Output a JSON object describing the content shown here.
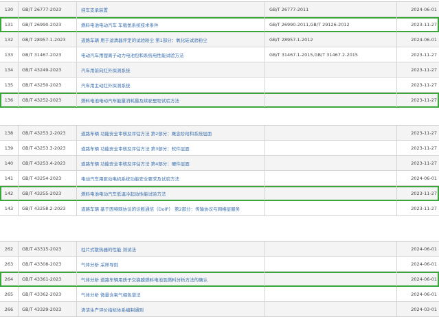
{
  "sections": [
    {
      "rows": [
        {
          "num": "130",
          "code": "GB/T 26777-2023",
          "title": "挂车支承装置",
          "replaces": "GB/T 26777-2011",
          "date": "2024-06-01",
          "highlight": false
        },
        {
          "num": "131",
          "code": "GB/T 26990-2023",
          "title": "燃料电池电动汽车 车载氢系统技术条件",
          "replaces": "GB/T 26990-2011,GB/T 29126-2012",
          "date": "2023-11-27",
          "highlight": true
        },
        {
          "num": "132",
          "code": "GB/T 28957.1-2023",
          "title": "道路车辆 用于滤清器评定的试验粉尘 第1部分：氧化硅试验粉尘",
          "replaces": "GB/T 28957.1-2012",
          "date": "2024-06-01",
          "highlight": false
        },
        {
          "num": "133",
          "code": "GB/T 31467-2023",
          "title": "电动汽车用锂离子动力电池包和系统电性能试验方法",
          "replaces": "GB/T 31467.1-2015,GB/T 31467.2-2015",
          "date": "2023-11-27",
          "highlight": false
        },
        {
          "num": "134",
          "code": "GB/T 43249-2023",
          "title": "汽车用前向红外探测系统",
          "replaces": "",
          "date": "2023-11-27",
          "highlight": false
        },
        {
          "num": "135",
          "code": "GB/T 43250-2023",
          "title": "汽车用主动红外探测系统",
          "replaces": "",
          "date": "2023-11-27",
          "highlight": false
        },
        {
          "num": "136",
          "code": "GB/T 43252-2023",
          "title": "燃料电池电动汽车能量消耗量及续驶里程试验方法",
          "replaces": "",
          "date": "2023-11-27",
          "highlight": true
        }
      ]
    },
    {
      "rows": [
        {
          "num": "138",
          "code": "GB/T 43253.2-2023",
          "title": "道路车辆 功能安全审核及评估方法 第2部分：概念阶段和系统层面",
          "replaces": "",
          "date": "2023-11-27",
          "highlight": false
        },
        {
          "num": "139",
          "code": "GB/T 43253.3-2023",
          "title": "道路车辆 功能安全审核及评估方法 第3部分：软件层面",
          "replaces": "",
          "date": "2023-11-27",
          "highlight": false
        },
        {
          "num": "140",
          "code": "GB/T 43253.4-2023",
          "title": "道路车辆 功能安全审核及评估方法 第4部分：硬件层面",
          "replaces": "",
          "date": "2023-11-27",
          "highlight": false
        },
        {
          "num": "141",
          "code": "GB/T 43254-2023",
          "title": "电动汽车用驱动电机系统功能安全要求及试验方法",
          "replaces": "",
          "date": "2024-06-01",
          "highlight": false
        },
        {
          "num": "142",
          "code": "GB/T 43255-2023",
          "title": "燃料电池电动汽车低温冷起动性能试验方法",
          "replaces": "",
          "date": "2023-11-27",
          "highlight": true
        },
        {
          "num": "143",
          "code": "GB/T 43258.2-2023",
          "title": "道路车辆 基于因特网协议的诊断通信（DoIP） 第2部分：传输协议与网络层服务",
          "replaces": "",
          "date": "2023-11-27",
          "highlight": false
        }
      ]
    },
    {
      "rows": [
        {
          "num": "262",
          "code": "GB/T 43315-2023",
          "title": "柱片式散热器的性能 测试法",
          "replaces": "",
          "date": "2024-06-01",
          "highlight": false
        },
        {
          "num": "263",
          "code": "GB/T 43308-2023",
          "title": "气体分析 采样导则",
          "replaces": "",
          "date": "2024-06-01",
          "highlight": false
        },
        {
          "num": "264",
          "code": "GB/T 43361-2023",
          "title": "气体分析 道路车辆用质子交换膜燃料电池氢燃料分析方法的确认",
          "replaces": "",
          "date": "2024-06-01",
          "highlight": true
        },
        {
          "num": "265",
          "code": "GB/T 43362-2023",
          "title": "气体分析 微量含氧气相色谱法",
          "replaces": "",
          "date": "2024-06-01",
          "highlight": false
        },
        {
          "num": "266",
          "code": "GB/T 43329-2023",
          "title": "清洁生产评价指标体系编制通则",
          "replaces": "",
          "date": "2024-03-01",
          "highlight": false
        }
      ]
    }
  ]
}
